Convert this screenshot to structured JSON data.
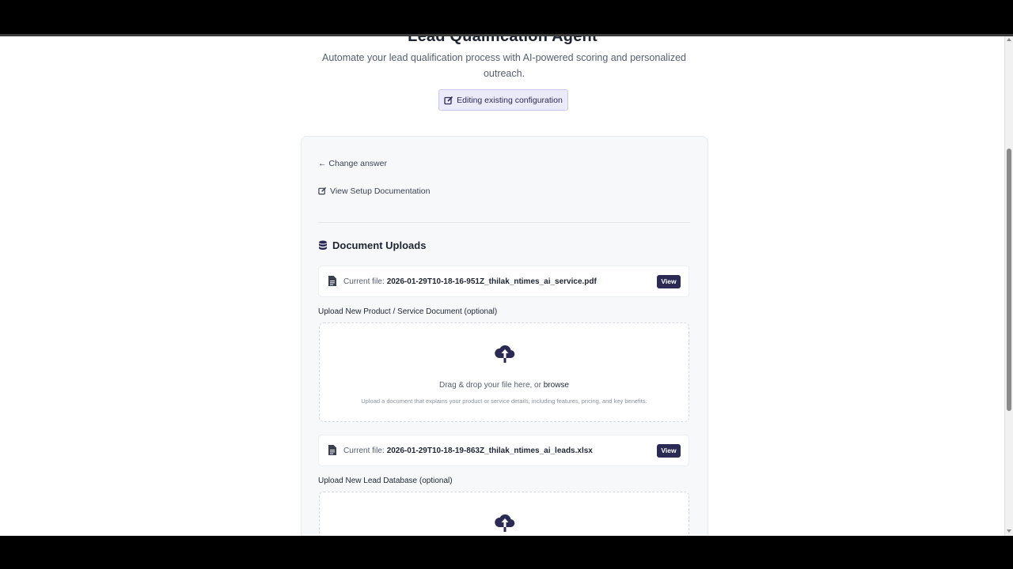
{
  "header": {
    "title": "Lead Qualification Agent",
    "subtitle": "Automate your lead qualification process with AI-powered scoring and personalized outreach.",
    "editing_badge": "Editing existing configuration"
  },
  "card": {
    "change_answer": "← Change answer",
    "setup_docs": "View Setup Documentation",
    "section_title": "Document Uploads",
    "files": [
      {
        "prefix": "Current file:",
        "name": "2026-01-29T10-18-16-951Z_thilak_ntimes_ai_service.pdf",
        "view_label": "View"
      },
      {
        "prefix": "Current file:",
        "name": "2026-01-29T10-18-19-863Z_thilak_ntimes_ai_leads.xlsx",
        "view_label": "View"
      }
    ],
    "uploads": [
      {
        "label": "Upload New Product / Service Document (optional)",
        "drop_text": "Drag & drop your file here, or",
        "browse": "browse",
        "hint": "Upload a document that explains your product or service details, including features, pricing, and key benefits."
      },
      {
        "label": "Upload New Lead Database (optional)"
      }
    ]
  },
  "colors": {
    "accent": "#2b2a55",
    "badge_bg": "#ebeaf8",
    "card_bg": "#f6f8fa"
  },
  "icons": {
    "edit": "edit-icon",
    "link": "external-link-icon",
    "database": "database-icon",
    "file": "file-icon",
    "upload": "cloud-upload-icon"
  }
}
